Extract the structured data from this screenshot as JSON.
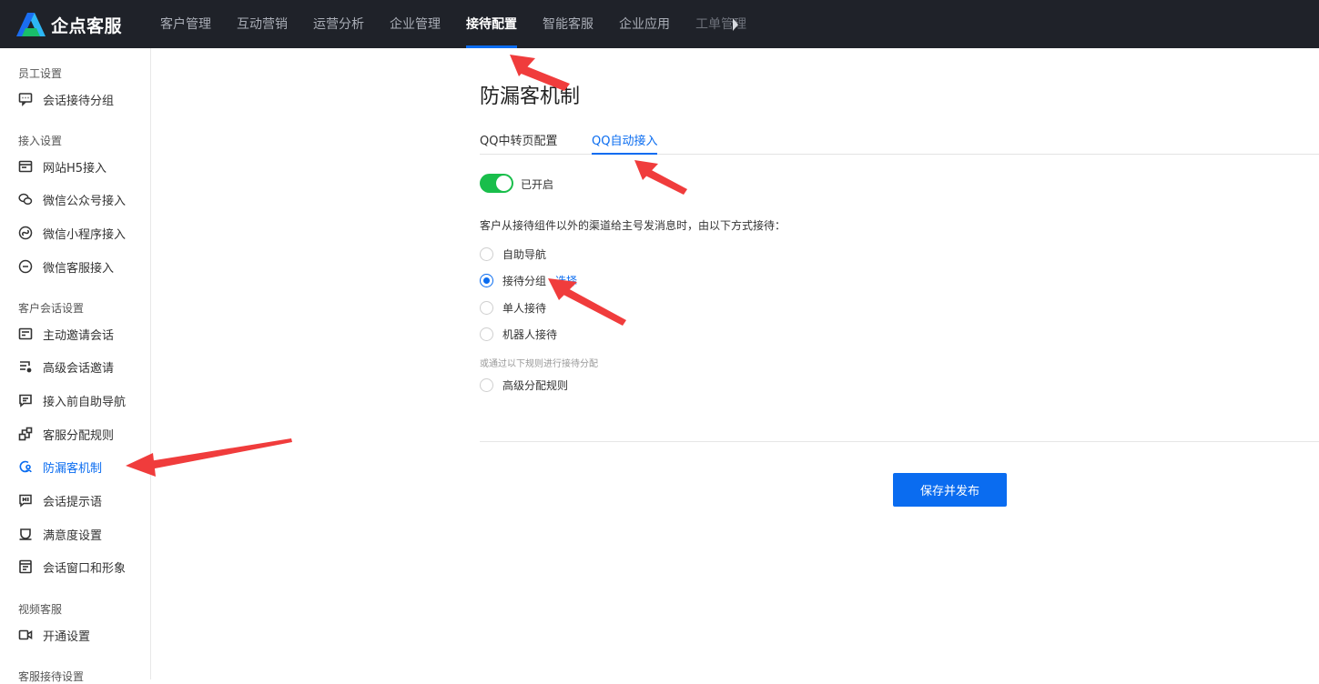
{
  "app": {
    "name": "企点客服",
    "brand_color": "#0a6cf0"
  },
  "nav": {
    "items": [
      {
        "label": "客户管理"
      },
      {
        "label": "互动营销"
      },
      {
        "label": "运营分析"
      },
      {
        "label": "企业管理"
      },
      {
        "label": "接待配置",
        "active": true
      },
      {
        "label": "智能客服"
      },
      {
        "label": "企业应用"
      },
      {
        "label": "工单管理"
      }
    ]
  },
  "sidebar": {
    "groups": [
      {
        "title": "员工设置",
        "items": [
          {
            "label": "会话接待分组",
            "icon": "chat-group-icon"
          }
        ]
      },
      {
        "title": "接入设置",
        "items": [
          {
            "label": "网站H5接入",
            "icon": "webpage-icon"
          },
          {
            "label": "微信公众号接入",
            "icon": "wechat-icon"
          },
          {
            "label": "微信小程序接入",
            "icon": "miniprogram-icon"
          },
          {
            "label": "微信客服接入",
            "icon": "wechat-service-icon"
          }
        ]
      },
      {
        "title": "客户会话设置",
        "items": [
          {
            "label": "主动邀请会话",
            "icon": "invite-icon"
          },
          {
            "label": "高级会话邀请",
            "icon": "advanced-invite-icon"
          },
          {
            "label": "接入前自助导航",
            "icon": "self-nav-icon"
          },
          {
            "label": "客服分配规则",
            "icon": "assign-rule-icon"
          },
          {
            "label": "防漏客机制",
            "icon": "anti-leak-icon",
            "active": true
          },
          {
            "label": "会话提示语",
            "icon": "hi-message-icon"
          },
          {
            "label": "满意度设置",
            "icon": "satisfaction-icon"
          },
          {
            "label": "会话窗口和形象",
            "icon": "window-icon"
          }
        ]
      },
      {
        "title": "视频客服",
        "items": [
          {
            "label": "开通设置",
            "icon": "video-icon"
          }
        ]
      },
      {
        "title": "客服接待设置",
        "items": []
      }
    ]
  },
  "main": {
    "title": "防漏客机制",
    "tabs": [
      {
        "label": "QQ中转页配置"
      },
      {
        "label": "QQ自动接入",
        "active": true
      }
    ],
    "toggle": {
      "on": true,
      "label": "已开启"
    },
    "description": "客户从接待组件以外的渠道给主号发消息时，由以下方式接待：",
    "options": [
      {
        "label": "自助导航",
        "checked": false
      },
      {
        "label": "接待分组",
        "checked": true,
        "link": "选择"
      },
      {
        "label": "单人接待",
        "checked": false
      },
      {
        "label": "机器人接待",
        "checked": false
      }
    ],
    "note": "或通过以下规则进行接待分配",
    "advanced_option": {
      "label": "高级分配规则",
      "checked": false
    },
    "save_label": "保存并发布"
  },
  "annotation_color": "#f03c3c"
}
